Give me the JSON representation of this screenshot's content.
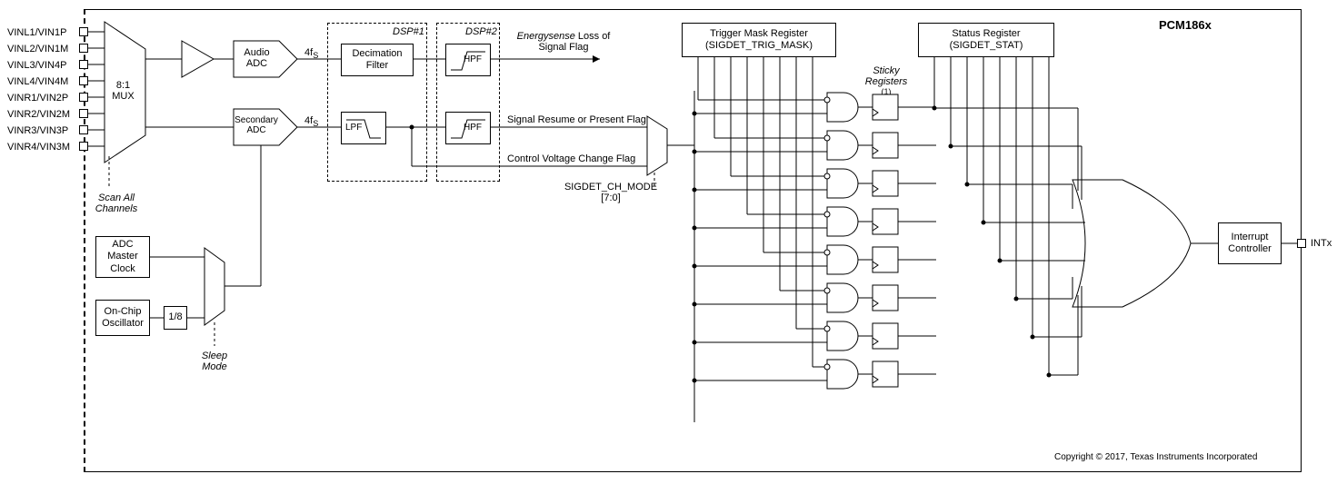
{
  "chip_name": "PCM186x",
  "copyright": "Copyright © 2017, Texas Instruments Incorporated",
  "inputs": [
    "VINL1/VIN1P",
    "VINL2/VIN1M",
    "VINL3/VIN4P",
    "VINL4/VIN4M",
    "VINR1/VIN2P",
    "VINR2/VIN2M",
    "VINR3/VIN3P",
    "VINR4/VIN3M"
  ],
  "mux": {
    "label": "8:1\nMUX"
  },
  "scan_label": "Scan All\nChannels",
  "audio_adc": "Audio\nADC",
  "secondary_adc": "Secondary\nADC",
  "rate_top": "4f",
  "rate_sub": "S",
  "dsp1": "DSP#1",
  "dsp2": "DSP#2",
  "decimation": "Decimation\nFilter",
  "hpf": "HPF",
  "lpf": "LPF",
  "energysense_line": "Energysense",
  "energysense_rest": " Loss of\nSignal Flag",
  "signal_resume": "Signal Resume or Present Flag",
  "control_voltage": "Control Voltage Change Flag",
  "sigdet_ch_mode": "SIGDET_CH_MODE\n[7:0]",
  "trigger_mask": "Trigger Mask Register\n(SIGDET_TRIG_MASK)",
  "status_reg": "Status Register\n(SIGDET_STAT)",
  "sticky_reg": "Sticky\nRegisters",
  "sticky_note": "(1)",
  "adc_master_clock": "ADC\nMaster\nClock",
  "onchip_osc": "On-Chip\nOscillator",
  "div8": "1/8",
  "sleep_mode": "Sleep\nMode",
  "interrupt_controller": "Interrupt\nController",
  "intx": "INTx"
}
